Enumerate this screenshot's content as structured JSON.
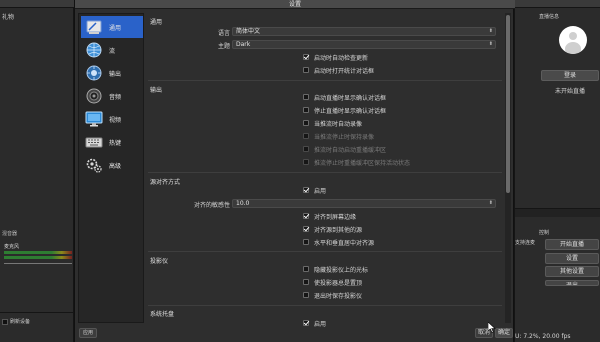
{
  "background": {
    "left_panel": {
      "scenes_title": "礼物",
      "mixer_title": "混音器",
      "mic_label": "麦克风",
      "refresh_label": "刷新设备"
    },
    "right_panel": {
      "title": "直播信息",
      "login_label": "登录",
      "status_text": "未开始直播",
      "controls_title": "控制",
      "support_label": "支持连麦",
      "start_stream_label": "开始直播",
      "settings_label": "设置",
      "other_settings_label": "其他设置",
      "exit_label": "退出",
      "cpu_text": "U: 7.2%, 20.00 fps"
    }
  },
  "dialog": {
    "title": "设置",
    "nav": [
      {
        "label": "通用",
        "icon": "general-icon",
        "active": true
      },
      {
        "label": "流",
        "icon": "globe-icon",
        "active": false
      },
      {
        "label": "输出",
        "icon": "output-icon",
        "active": false
      },
      {
        "label": "音频",
        "icon": "speaker-icon",
        "active": false
      },
      {
        "label": "视频",
        "icon": "monitor-icon",
        "active": false
      },
      {
        "label": "热键",
        "icon": "keyboard-icon",
        "active": false
      },
      {
        "label": "高级",
        "icon": "gears-icon",
        "active": false
      }
    ],
    "apply_label": "应用",
    "cancel_label": "取消",
    "ok_label": "确定",
    "general": {
      "title": "通用",
      "language_label": "语言",
      "language_value": "简体中文",
      "theme_label": "主题",
      "theme_value": "Dark",
      "auto_update": {
        "label": "启动时自动检查更新",
        "checked": true
      },
      "stats_on_start": {
        "label": "启动时打开统计对话框",
        "checked": false
      }
    },
    "output": {
      "title": "输出",
      "items": [
        {
          "label": "启动直播时显示确认对话框",
          "checked": false,
          "disabled": false
        },
        {
          "label": "停止直播时显示确认对话框",
          "checked": false,
          "disabled": false
        },
        {
          "label": "当推流时自动录像",
          "checked": false,
          "disabled": false
        },
        {
          "label": "当推流停止时保持录像",
          "checked": false,
          "disabled": true
        },
        {
          "label": "推流时自动启动重播缓冲区",
          "checked": false,
          "disabled": true
        },
        {
          "label": "推流停止时重播缓冲区保持活动状态",
          "checked": false,
          "disabled": true
        }
      ]
    },
    "snapping": {
      "title": "源对齐方式",
      "enable": {
        "label": "启用",
        "checked": true
      },
      "sensitivity_label": "对齐的敏感性",
      "sensitivity_value": "10.0",
      "items": [
        {
          "label": "对齐到屏幕边缘",
          "checked": true
        },
        {
          "label": "对齐源到其他的源",
          "checked": true
        },
        {
          "label": "水平和垂直居中对齐源",
          "checked": false
        }
      ]
    },
    "projector": {
      "title": "投影仪",
      "items": [
        {
          "label": "隐藏投影仪上的光标",
          "checked": false
        },
        {
          "label": "使投影器总是置顶",
          "checked": false
        },
        {
          "label": "退出时保存投影仪",
          "checked": false
        }
      ]
    },
    "tray": {
      "title": "系统托盘",
      "enable": {
        "label": "启用",
        "checked": true
      }
    }
  }
}
